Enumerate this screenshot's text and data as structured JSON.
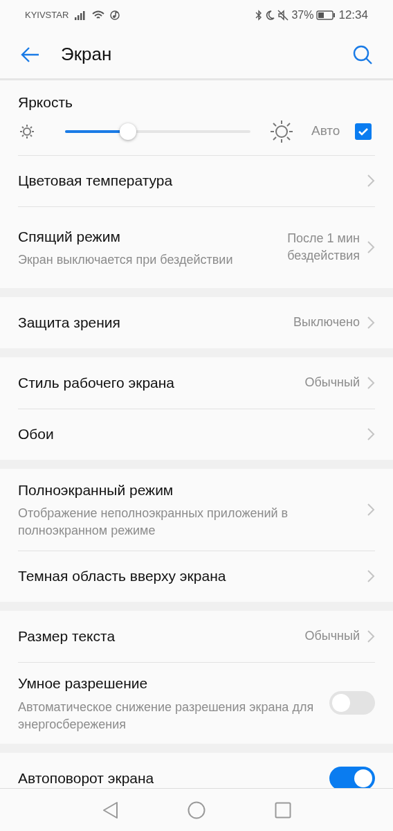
{
  "status_bar": {
    "carrier": "KYIVSTAR",
    "battery": "37%",
    "time": "12:34"
  },
  "header": {
    "title": "Экран"
  },
  "brightness": {
    "label": "Яркость",
    "level": 0.34,
    "auto_label": "Авто",
    "auto": true
  },
  "groups": [
    [
      {
        "kind": "link",
        "title": "Цветовая температура"
      },
      {
        "kind": "link",
        "title": "Спящий режим",
        "subtitle": "Экран выключается при бездействии",
        "value": "После 1 мин бездействия"
      }
    ],
    [
      {
        "kind": "link",
        "title": "Защита зрения",
        "value": "Выключено"
      }
    ],
    [
      {
        "kind": "link",
        "title": "Стиль рабочего экрана",
        "value": "Обычный"
      },
      {
        "kind": "link",
        "title": "Обои"
      }
    ],
    [
      {
        "kind": "link",
        "title": "Полноэкранный режим",
        "subtitle": "Отображение неполноэкранных приложений в полноэкранном режиме"
      },
      {
        "kind": "link",
        "title": "Темная область вверху экрана"
      }
    ],
    [
      {
        "kind": "link",
        "title": "Размер текста",
        "value": "Обычный"
      },
      {
        "kind": "switch",
        "title": "Умное разрешение",
        "subtitle": "Автоматическое снижение разрешения экрана для энергосбережения",
        "on": false
      }
    ],
    [
      {
        "kind": "switch",
        "title": "Автоповорот экрана",
        "on": true
      }
    ]
  ]
}
